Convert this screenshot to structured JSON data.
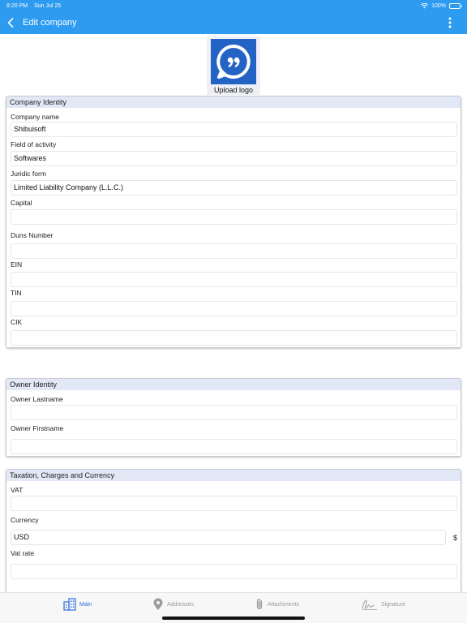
{
  "status_bar": {
    "time": "8:20 PM",
    "date": "Sun Jul 25",
    "battery": "100%"
  },
  "nav": {
    "title": "Edit company"
  },
  "logo": {
    "label": "Upload logo"
  },
  "sections": {
    "company_identity": {
      "title": "Company Identity",
      "company_name": {
        "label": "Company name",
        "value": "Shibuisoft"
      },
      "field_of_activity": {
        "label": "Field of activity",
        "value": "Softwares"
      },
      "juridic_form": {
        "label": "Juridic form",
        "value": "Limited Liability Company (L.L.C.)"
      },
      "capital": {
        "label": "Capital",
        "value": ""
      },
      "duns_number": {
        "label": "Duns Number",
        "value": ""
      },
      "ein": {
        "label": "EIN",
        "value": ""
      },
      "tin": {
        "label": "TIN",
        "value": ""
      },
      "cik": {
        "label": "CIK",
        "value": ""
      }
    },
    "owner_identity": {
      "title": "Owner Identity",
      "owner_lastname": {
        "label": "Owner Lastname",
        "value": ""
      },
      "owner_firstname": {
        "label": "Owner Firstname",
        "value": ""
      }
    },
    "taxation": {
      "title": "Taxation, Charges and Currency",
      "vat": {
        "label": "VAT",
        "value": ""
      },
      "currency": {
        "label": "Currency",
        "value": "USD",
        "symbol": "$"
      },
      "vat_rate": {
        "label": "Vat rate",
        "value": ""
      }
    }
  },
  "tabs": [
    {
      "label": "Main",
      "icon": "building-icon",
      "active": true
    },
    {
      "label": "Addresses",
      "icon": "map-pin-icon",
      "active": false
    },
    {
      "label": "Attachments",
      "icon": "paperclip-icon",
      "active": false
    },
    {
      "label": "Signature",
      "icon": "signature-icon",
      "active": false
    }
  ],
  "colors": {
    "accent": "#2d9bf0",
    "logo_bg": "#2463c6",
    "tab_active": "#2d6ee0",
    "tab_inactive": "#9a9aa0"
  }
}
